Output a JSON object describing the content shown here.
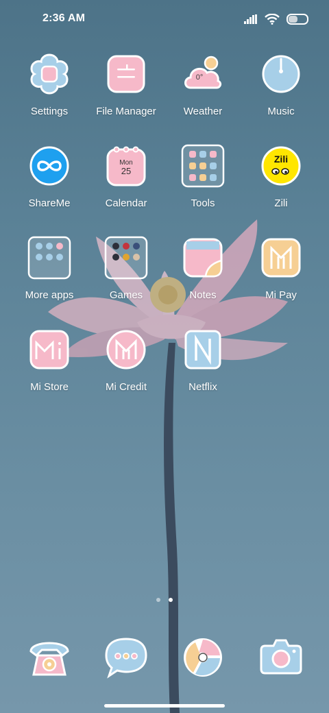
{
  "status_bar": {
    "time": "2:36 AM",
    "battery_level": 0.55
  },
  "home": {
    "rows": [
      [
        {
          "label": "Settings",
          "icon": "settings-icon"
        },
        {
          "label": "File Manager",
          "icon": "folder-icon"
        },
        {
          "label": "Weather",
          "icon": "weather-icon",
          "temp": "0°"
        },
        {
          "label": "Music",
          "icon": "music-icon"
        }
      ],
      [
        {
          "label": "ShareMe",
          "icon": "shareme-icon"
        },
        {
          "label": "Calendar",
          "icon": "calendar-icon",
          "day": "Mon",
          "date": "25"
        },
        {
          "label": "Tools",
          "icon": "tools-folder-icon"
        },
        {
          "label": "Zili",
          "icon": "zili-icon",
          "brand": "Zili"
        }
      ],
      [
        {
          "label": "More apps",
          "icon": "more-apps-folder-icon"
        },
        {
          "label": "Games",
          "icon": "games-folder-icon"
        },
        {
          "label": "Notes",
          "icon": "notes-icon"
        },
        {
          "label": "Mi Pay",
          "icon": "mi-pay-icon"
        }
      ],
      [
        {
          "label": "Mi Store",
          "icon": "mi-store-icon"
        },
        {
          "label": "Mi Credit",
          "icon": "mi-credit-icon"
        },
        {
          "label": "Netflix",
          "icon": "netflix-icon"
        }
      ]
    ]
  },
  "pager": {
    "pages": 2,
    "current": 2
  },
  "dock": [
    {
      "icon": "phone-icon"
    },
    {
      "icon": "messages-icon"
    },
    {
      "icon": "browser-icon"
    },
    {
      "icon": "camera-icon"
    }
  ],
  "colors": {
    "pink": "#f6b9c9",
    "blue": "#a7cfe8",
    "peach": "#f6cf94",
    "outline": "#ffffff"
  }
}
